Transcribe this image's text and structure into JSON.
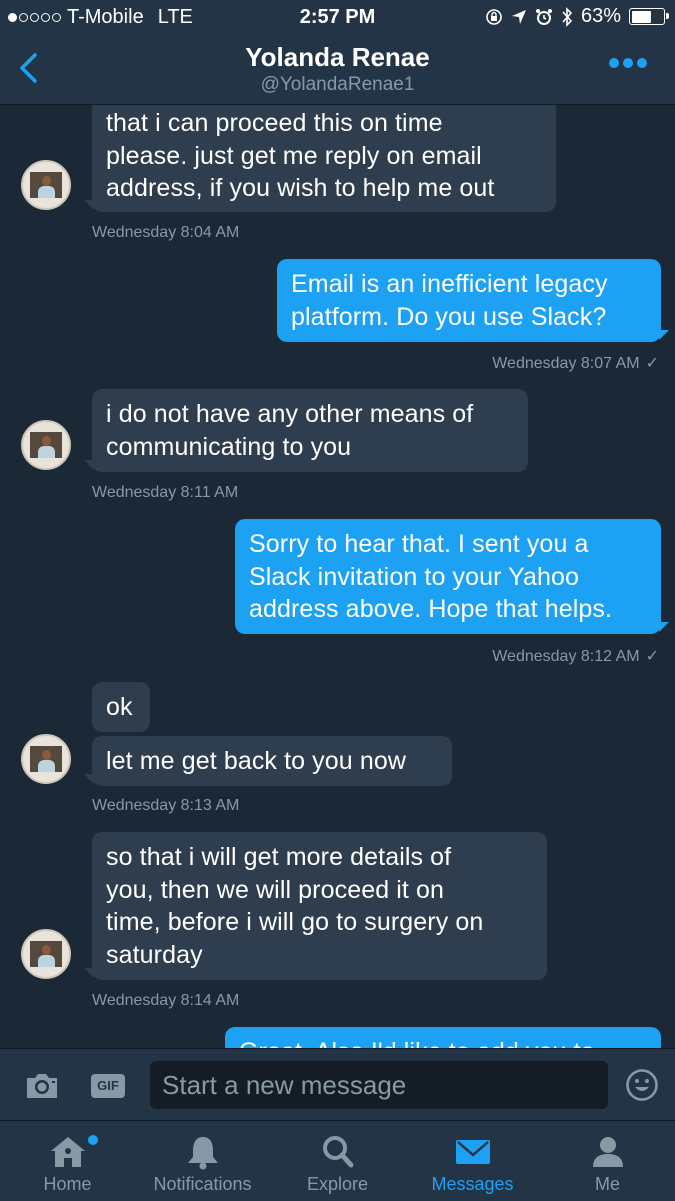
{
  "status_bar": {
    "carrier": "T-Mobile",
    "network": "LTE",
    "time": "2:57 PM",
    "battery_percent": "63%",
    "battery_level": 0.63
  },
  "header": {
    "name": "Yolanda Renae",
    "handle": "@YolandaRenae1"
  },
  "messages": [
    {
      "text": "that i can proceed this on time please. just get me reply on email address, if you wish to help me out",
      "lines": [
        "that i can proceed this on time",
        "please. just get me reply on email",
        "address, if you wish to help me out"
      ],
      "direction": "incoming",
      "time": "Wednesday 8:04 AM"
    },
    {
      "text": "Email is an inefficient legacy platform. Do you use Slack?",
      "lines": [
        "Email is an inefficient legacy",
        "platform. Do you use Slack?"
      ],
      "direction": "outgoing",
      "time": "Wednesday 8:07 AM"
    },
    {
      "text": "i do not have any other means of communicating to you",
      "lines": [
        "i do not have any other means of",
        "communicating to you"
      ],
      "direction": "incoming",
      "time": "Wednesday 8:11 AM"
    },
    {
      "text": "Sorry to hear that. I sent you a Slack invitation to your Yahoo address above. Hope that helps.",
      "lines": [
        "Sorry to hear that. I sent you a",
        "Slack invitation to your Yahoo",
        "address above. Hope that helps."
      ],
      "direction": "outgoing",
      "time": "Wednesday 8:12 AM"
    },
    {
      "text": "ok",
      "lines": [
        "ok"
      ],
      "direction": "incoming",
      "time": ""
    },
    {
      "text": "let me get back to you now",
      "lines": [
        "let me get back to you now"
      ],
      "direction": "incoming",
      "time": "Wednesday 8:13 AM"
    },
    {
      "text": "so that i will get more details of you, then we will proceed it on time, before i will go to surgery on saturday",
      "lines": [
        "so that i will get more details of",
        "you, then we will proceed it on",
        "time, before i will go to surgery on",
        "saturday"
      ],
      "direction": "incoming",
      "time": "Wednesday 8:14 AM"
    },
    {
      "text": "Great. Also I'd like to add you to",
      "lines": [
        "Great. Also I'd like to add you to"
      ],
      "direction": "outgoing",
      "time": ""
    }
  ],
  "read_check": "✓",
  "composer": {
    "placeholder": "Start a new message",
    "gif_label": "GIF",
    "camera_icon": "camera-icon",
    "emoji_icon": "emoji-icon"
  },
  "tabs": [
    {
      "label": "Home",
      "icon": "home-icon",
      "active": false,
      "has_badge": true
    },
    {
      "label": "Notifications",
      "icon": "bell-icon",
      "active": false
    },
    {
      "label": "Explore",
      "icon": "search-icon",
      "active": false
    },
    {
      "label": "Messages",
      "icon": "envelope-icon",
      "active": true
    },
    {
      "label": "Me",
      "icon": "person-icon",
      "active": false
    }
  ],
  "colors": {
    "background": "#1b2836",
    "bar": "#243447",
    "incoming_bubble": "#2f3e4f",
    "outgoing_bubble": "#1da1f2",
    "muted_text": "#8899a6",
    "accent": "#1da1f2"
  }
}
